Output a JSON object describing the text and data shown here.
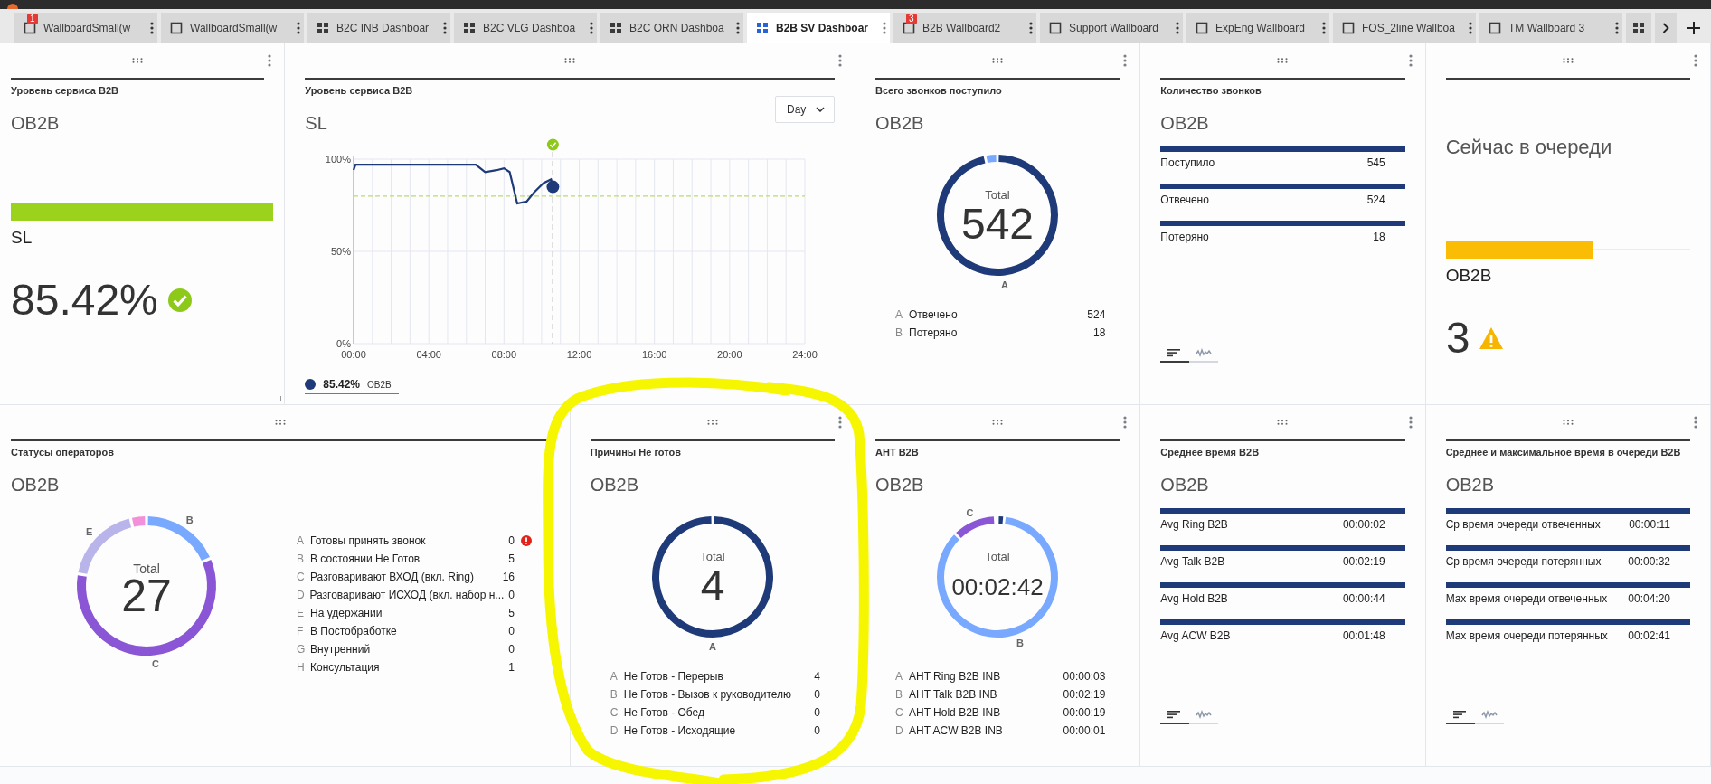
{
  "tabs": [
    {
      "label": "WallboardSmall(w",
      "kind": "single",
      "badge": "1",
      "selected": false
    },
    {
      "label": "WallboardSmall(w",
      "kind": "single",
      "selected": false
    },
    {
      "label": "B2C INB Dashboar",
      "kind": "grid",
      "selected": false
    },
    {
      "label": "B2C VLG Dashboa",
      "kind": "grid",
      "selected": false
    },
    {
      "label": "B2C ORN Dashboa",
      "kind": "grid",
      "selected": false
    },
    {
      "label": "B2B SV Dashboar",
      "kind": "grid",
      "selected": true
    },
    {
      "label": "B2B Wallboard2",
      "kind": "single",
      "badge": "3",
      "selected": false
    },
    {
      "label": "Support Wallboard",
      "kind": "single",
      "selected": false
    },
    {
      "label": "ExpEng Wallboard",
      "kind": "single",
      "selected": false
    },
    {
      "label": "FOS_2line Wallboa",
      "kind": "single",
      "selected": false
    },
    {
      "label": "TM Wallboard 3",
      "kind": "single",
      "selected": false
    },
    {
      "kind": "grid",
      "selected": false
    }
  ],
  "panels": [
    {
      "kind": "gauge",
      "title": "Уровень сервиса B2B",
      "subtitle": "OB2B",
      "label": "SL",
      "value": "85.42%"
    },
    {
      "kind": "line",
      "wide": true,
      "title": "Уровень сервиса B2B",
      "subtitle": "SL",
      "period": "Day",
      "legend_value": "85.42%",
      "chart_data": {
        "type": "line",
        "x": [
          0,
          0.1,
          6.5,
          7,
          7.6,
          8,
          8.3,
          8.7,
          9.2,
          9.6,
          10.1,
          10.5,
          10.6
        ],
        "series": [
          {
            "name": "OB2B",
            "color": "#1f3a78",
            "values": [
              94,
              97,
              97,
              93,
              94,
              95,
              93,
              76,
              77,
              82,
              87,
              89,
              85
            ]
          }
        ],
        "xlim": [
          0,
          24
        ],
        "ylim": [
          0,
          100
        ],
        "xticks": [
          {
            "value": 0,
            "label": "00:00"
          },
          {
            "value": 4,
            "label": "04:00"
          },
          {
            "value": 8,
            "label": "08:00"
          },
          {
            "value": 12,
            "label": "12:00"
          },
          {
            "value": 16,
            "label": "16:00"
          },
          {
            "value": 20,
            "label": "20:00"
          },
          {
            "value": 24,
            "label": "24:00"
          }
        ],
        "yticks": [
          {
            "value": 0,
            "label": "0%"
          },
          {
            "value": 50,
            "label": "50%"
          },
          {
            "value": 100,
            "label": "100%"
          }
        ],
        "grid": true,
        "ref_lines": [
          {
            "axis": "y",
            "value": 80
          },
          {
            "axis": "x",
            "value": 10.6
          }
        ]
      }
    },
    {
      "kind": "donut",
      "title": "Всего звонков поступило",
      "subtitle": "OB2B",
      "total_label": "Total",
      "total": "542",
      "items": [
        {
          "letter": "A",
          "label": "Отвечено",
          "value": "524",
          "color": "#1f3a78",
          "ring_label": "A"
        },
        {
          "letter": "B",
          "label": "Потеряно",
          "value": "18",
          "color": "#78a9ff"
        }
      ]
    },
    {
      "kind": "bars",
      "title": "Количество звонков",
      "subtitle": "OB2B",
      "rows": [
        {
          "label": "Поступило",
          "value": "545"
        },
        {
          "label": "Отвечено",
          "value": "524"
        },
        {
          "label": "Потеряно",
          "value": "18"
        }
      ],
      "views": [
        {
          "kind": "bars",
          "selected": true
        },
        {
          "kind": "wave",
          "selected": false
        }
      ]
    },
    {
      "kind": "queue",
      "heading": "Сейчас в очереди",
      "level": 0.6,
      "label": "OB2B",
      "value": "3"
    },
    {
      "kind": "donut",
      "wide": true,
      "title": "Статусы операторов",
      "subtitle": "OB2B",
      "total_label": "Total",
      "total": "27",
      "items": [
        {
          "letter": "A",
          "label": "Готовы принять звонок",
          "value": "0",
          "alert": true
        },
        {
          "letter": "B",
          "label": "В состоянии Не Готов",
          "value": "5",
          "color": "#78a9ff",
          "ring_label": "B",
          "alert": false
        },
        {
          "letter": "C",
          "label": "Разговаривают ВХОД (вкл. Ring)",
          "value": "16",
          "color": "#8a56d6",
          "ring_label": "C",
          "alert": false
        },
        {
          "letter": "D",
          "label": "Разговаривают ИСХОД (вкл. набор н...",
          "value": "0",
          "alert": false
        },
        {
          "letter": "E",
          "label": "На удержании",
          "value": "5",
          "color": "#b9b4ea",
          "ring_label": "E",
          "alert": false
        },
        {
          "letter": "F",
          "label": "В Постобработке",
          "value": "0",
          "alert": false
        },
        {
          "letter": "G",
          "label": "Внутренний",
          "value": "0",
          "alert": false
        },
        {
          "letter": "H",
          "label": "Консультация",
          "value": "1",
          "color": "#f291d9",
          "alert": false
        }
      ]
    },
    {
      "kind": "donut",
      "title": "Причины Не готов",
      "subtitle": "OB2B",
      "total_label": "Total",
      "total": "4",
      "items": [
        {
          "letter": "A",
          "label": "Не Готов - Перерыв",
          "value": "4",
          "color": "#1f3a78",
          "ring_label": "A"
        },
        {
          "letter": "B",
          "label": "Не Готов - Вызов к руководителю",
          "value": "0"
        },
        {
          "letter": "C",
          "label": "Не Готов - Обед",
          "value": "0"
        },
        {
          "letter": "D",
          "label": "Не Готов - Исходящие",
          "value": "0"
        }
      ]
    },
    {
      "kind": "donut",
      "title": "AHT B2B",
      "subtitle": "OB2B",
      "total_label": "Total",
      "total": "00:02:42",
      "items": [
        {
          "letter": "A",
          "label": "AHT Ring B2B INB",
          "value": "00:00:03",
          "color": "#1f3a78"
        },
        {
          "letter": "B",
          "label": "AHT Talk B2B INB",
          "value": "00:02:19",
          "color": "#78a9ff",
          "ring_label": "B"
        },
        {
          "letter": "C",
          "label": "AHT Hold B2B INB",
          "value": "00:00:19",
          "color": "#8a56d6",
          "ring_label": "C"
        },
        {
          "letter": "D",
          "label": "AHT ACW B2B INB",
          "value": "00:00:01"
        }
      ]
    },
    {
      "kind": "bars",
      "title": "Среднее время B2B",
      "subtitle": "OB2B",
      "rows": [
        {
          "label": "Avg Ring B2B",
          "value": "00:00:02"
        },
        {
          "label": "Avg Talk B2B",
          "value": "00:02:19"
        },
        {
          "label": "Avg Hold B2B",
          "value": "00:00:44"
        },
        {
          "label": "Avg ACW B2B",
          "value": "00:01:48"
        }
      ],
      "views": [
        {
          "kind": "bars",
          "selected": true
        },
        {
          "kind": "wave",
          "selected": false
        }
      ]
    },
    {
      "kind": "bars",
      "title": "Среднее и максимальное время в очереди B2B",
      "subtitle": "OB2B",
      "rows": [
        {
          "label": "Ср время очереди отвеченных",
          "value": "00:00:11"
        },
        {
          "label": "Ср время очереди потерянных",
          "value": "00:00:32"
        },
        {
          "label": "Max время очереди отвеченных",
          "value": "00:04:20"
        },
        {
          "label": "Max время очереди потерянных",
          "value": "00:02:41"
        }
      ],
      "views": [
        {
          "kind": "bars",
          "selected": true
        },
        {
          "kind": "wave",
          "selected": false
        }
      ]
    }
  ]
}
